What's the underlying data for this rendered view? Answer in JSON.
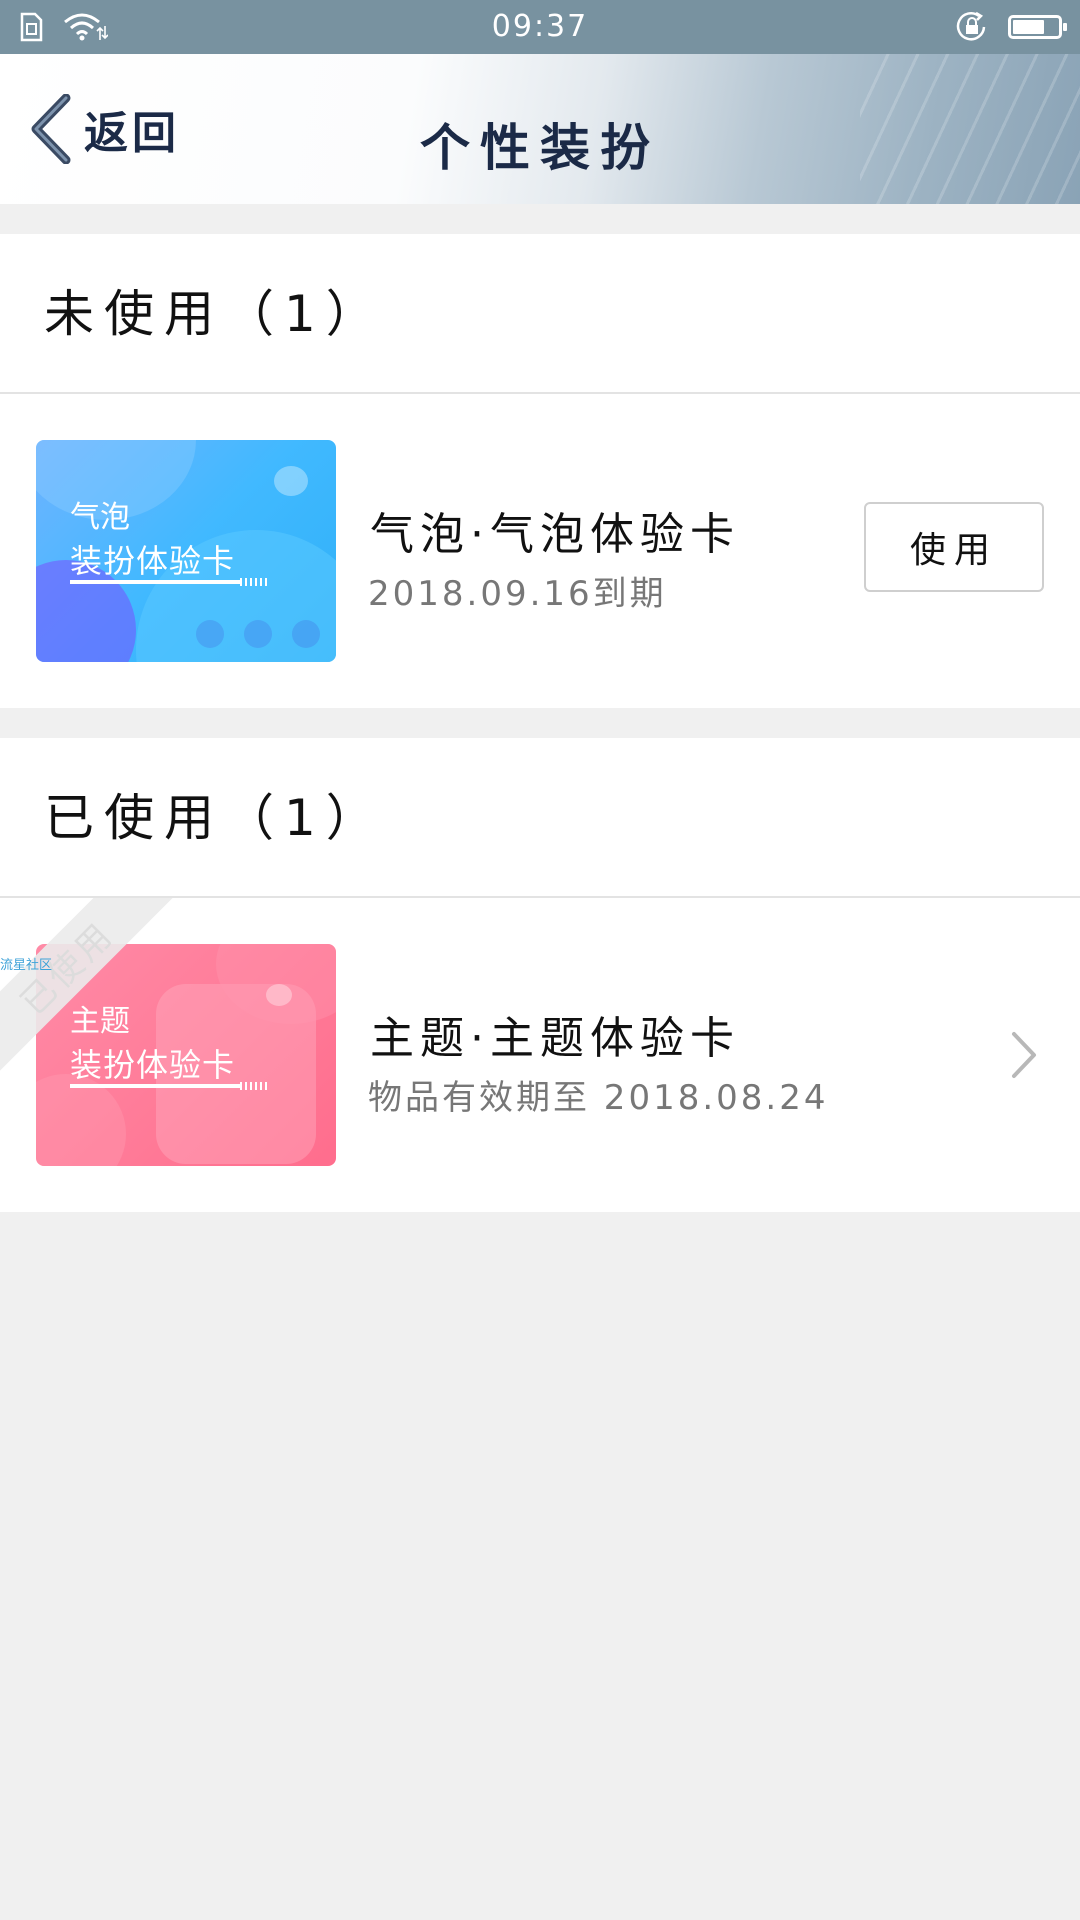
{
  "status_bar": {
    "time": "09:37",
    "icons": [
      "sim-card-icon",
      "wifi-icon",
      "rotation-lock-icon",
      "battery-icon"
    ],
    "battery_level": 0.65
  },
  "header": {
    "back_label": "返回",
    "title": "个性装扮"
  },
  "sections": [
    {
      "heading": "未使用（1）",
      "items": [
        {
          "card_line1": "气泡",
          "card_line2": "装扮体验卡",
          "title": "气泡·气泡体验卡",
          "subtitle": "2018.09.16到期",
          "action_label": "使用",
          "card_color": "#3db8ff"
        }
      ]
    },
    {
      "heading": "已使用（1）",
      "items": [
        {
          "card_line1": "主题",
          "card_line2": "装扮体验卡",
          "title": "主题·主题体验卡",
          "subtitle": "物品有效期至 2018.08.24",
          "ribbon_label": "已使用",
          "watermark": "流星社区",
          "card_color": "#ff7b98"
        }
      ]
    }
  ]
}
